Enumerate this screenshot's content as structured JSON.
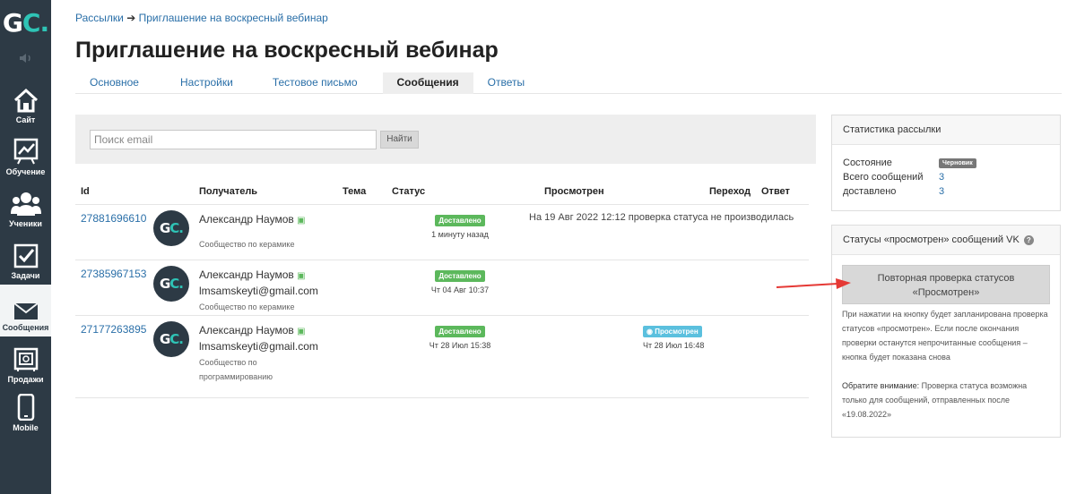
{
  "sidebar": {
    "logo": {
      "g": "G",
      "c": "C",
      "dot": "."
    },
    "items": [
      {
        "label": "Сайт",
        "icon": "house-icon"
      },
      {
        "label": "Обучение",
        "icon": "chart-board-icon"
      },
      {
        "label": "Ученики",
        "icon": "users-icon"
      },
      {
        "label": "Задачи",
        "icon": "checkbox-icon"
      },
      {
        "label": "Сообщения",
        "icon": "envelope-icon"
      },
      {
        "label": "Продажи",
        "icon": "safe-icon"
      },
      {
        "label": "Mobile",
        "icon": "mobile-icon"
      }
    ]
  },
  "breadcrumb": {
    "root": "Рассылки",
    "sep": "➔",
    "current": "Приглашение на воскресный вебинар"
  },
  "page_title": "Приглашение на воскресный вебинар",
  "tabs": [
    {
      "label": "Основное"
    },
    {
      "label": "Настройки"
    },
    {
      "label": "Тестовое письмо"
    },
    {
      "label": "Сообщения"
    },
    {
      "label": "Ответы"
    }
  ],
  "search": {
    "placeholder": "Поиск email",
    "button": "Найти"
  },
  "table": {
    "headers": {
      "id": "Id",
      "recipient": "Получатель",
      "subject": "Тема",
      "status": "Статус",
      "viewed": "Просмотрен",
      "click": "Переход",
      "reply": "Ответ"
    },
    "rows": [
      {
        "id": "27881696610",
        "name": "Александр Наумов",
        "email": "",
        "source": "Сообщество по керамике",
        "status": "Доставлено",
        "status_time": "1 минуту назад",
        "viewed_badge": "",
        "viewed_text": "На 19 Авг 2022 12:12 проверка статуса не производилась"
      },
      {
        "id": "27385967153",
        "name": "Александр Наумов",
        "email": "lmsamskeyti@gmail.com",
        "source": "Сообщество по керамике",
        "status": "Доставлено",
        "status_time": "Чт 04 Авг 10:37",
        "viewed_badge": "",
        "viewed_text": ""
      },
      {
        "id": "27177263895",
        "name": "Александр Наумов",
        "email": "lmsamskeyti@gmail.com",
        "source": "Сообщество по программированию",
        "status": "Доставлено",
        "status_time": "Чт 28 Июл 15:38",
        "viewed_badge": "Просмотрен",
        "viewed_text": "Чт 28 Июл 16:48"
      }
    ]
  },
  "stats": {
    "title": "Статистика рассылки",
    "state_label": "Состояние",
    "state_value": "Черновик",
    "total_label": "Всего сообщений",
    "total_value": "3",
    "delivered_label": "доставлено",
    "delivered_value": "3"
  },
  "vk": {
    "title": "Статусы «просмотрен» сообщений VK",
    "help": "?",
    "button_line1": "Повторная проверка статусов",
    "button_line2": "«Просмотрен»",
    "note1": "При нажатии на кнопку будет запланирована проверка статусов «просмотрен». Если после окончания проверки останутся непрочитанные сообщения – кнопка будет показана снова",
    "note2_bold": "Обратите внимание:",
    "note2": " Проверка статуса возможна только для сообщений, отправленных после «19.08.2022»"
  },
  "colors": {
    "sidebar": "#2d3a45",
    "accent": "#2ec4b6",
    "link": "#2a6fa8",
    "delivered": "#5cb85c",
    "viewed": "#5bc0de",
    "arrow": "#e53935"
  }
}
